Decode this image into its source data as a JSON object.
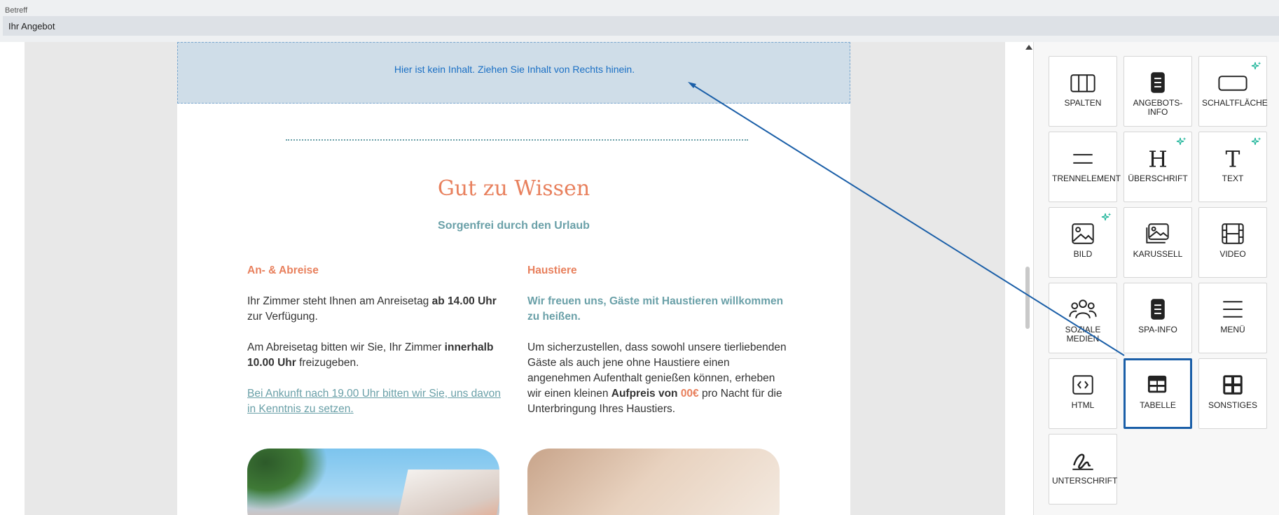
{
  "subject": {
    "label": "Betreff",
    "value": "Ihr Angebot"
  },
  "dropzone": {
    "text": "Hier ist kein Inhalt. Ziehen Sie Inhalt von Rechts hinein."
  },
  "email": {
    "headline": "Gut zu Wissen",
    "subline": "Sorgenfrei durch den Urlaub",
    "left": {
      "title": "An- & Abreise",
      "p1_a": "Ihr Zimmer steht Ihnen am Anreisetag ",
      "p1_b": "ab 14.00 Uhr",
      "p1_c": " zur Verfügung.",
      "p2_a": "Am Abreisetag bitten wir Sie, Ihr Zimmer ",
      "p2_b": "innerhalb 10.00 Uhr",
      "p2_c": " freizugeben.",
      "link": "Bei Ankunft nach 19.00 Uhr bitten wir Sie, uns davon in Kenntnis zu setzen."
    },
    "right": {
      "title": "Haustiere",
      "intro": "Wir freuen uns, Gäste mit Haustieren willkommen zu heißen.",
      "p_a": "Um sicherzustellen, dass sowohl unsere tierliebenden Gäste als auch jene ohne Haustiere einen angenehmen Aufenthalt genießen können, erheben wir einen kleinen ",
      "p_b": "Aufpreis von ",
      "p_price": "00€",
      "p_c": " pro Nacht für die Unterbringung Ihres Haustiers."
    }
  },
  "panel": {
    "tiles": [
      {
        "label": "SPALTEN",
        "icon": "columns-icon",
        "sparkle": false
      },
      {
        "label": "ANGEBOTS-INFO",
        "icon": "document-icon",
        "sparkle": false
      },
      {
        "label": "SCHALTFLÄCHE",
        "icon": "button-icon",
        "sparkle": true
      },
      {
        "label": "TRENNELEMENT",
        "icon": "divider-icon",
        "sparkle": false
      },
      {
        "label": "ÜBERSCHRIFT",
        "icon": "heading-icon",
        "sparkle": true
      },
      {
        "label": "TEXT",
        "icon": "text-icon",
        "sparkle": true
      },
      {
        "label": "BILD",
        "icon": "image-icon",
        "sparkle": true
      },
      {
        "label": "KARUSSELL",
        "icon": "carousel-icon",
        "sparkle": false
      },
      {
        "label": "VIDEO",
        "icon": "video-icon",
        "sparkle": false
      },
      {
        "label": "SOZIALE MEDIEN",
        "icon": "social-icon",
        "sparkle": false
      },
      {
        "label": "SPA-INFO",
        "icon": "spa-document-icon",
        "sparkle": false
      },
      {
        "label": "MENÜ",
        "icon": "menu-icon",
        "sparkle": false
      },
      {
        "label": "HTML",
        "icon": "code-icon",
        "sparkle": false
      },
      {
        "label": "TABELLE",
        "icon": "table-icon",
        "sparkle": false
      },
      {
        "label": "SONSTIGES",
        "icon": "grid-icon",
        "sparkle": false
      },
      {
        "label": "UNTERSCHRIFT",
        "icon": "signature-icon",
        "sparkle": false
      }
    ],
    "selected": "TABELLE"
  },
  "colors": {
    "accent_orange": "#e8805d",
    "accent_teal": "#6aa0a8",
    "selection": "#1b5fa8",
    "dropzone_text": "#1a6fc4"
  }
}
